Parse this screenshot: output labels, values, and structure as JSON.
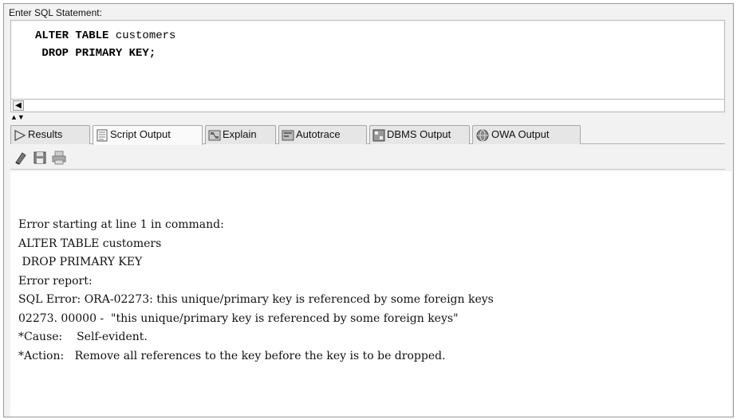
{
  "editor": {
    "label": "Enter SQL Statement:",
    "lines": [
      {
        "kw1": "ALTER TABLE",
        "rest": " customers"
      },
      {
        "kw1": " DROP PRIMARY KEY;",
        "rest": ""
      }
    ]
  },
  "tabs": [
    {
      "label": "Results",
      "icon": "play-arrow-icon"
    },
    {
      "label": "Script Output",
      "icon": "document-icon",
      "active": true
    },
    {
      "label": "Explain",
      "icon": "explain-plan-icon"
    },
    {
      "label": "Autotrace",
      "icon": "autotrace-icon"
    },
    {
      "label": "DBMS Output",
      "icon": "dbms-output-icon"
    },
    {
      "label": "OWA Output",
      "icon": "globe-icon"
    }
  ],
  "toolbar": {
    "icons": [
      "eraser-icon",
      "save-icon",
      "print-icon"
    ]
  },
  "output": {
    "lines": [
      "Error starting at line 1 in command:",
      "ALTER TABLE customers",
      " DROP PRIMARY KEY",
      "Error report:",
      "SQL Error: ORA-02273: this unique/primary key is referenced by some foreign keys",
      "02273. 00000 -  \"this unique/primary key is referenced by some foreign keys\"",
      "*Cause:    Self-evident.",
      "*Action:   Remove all references to the key before the key is to be dropped."
    ]
  }
}
